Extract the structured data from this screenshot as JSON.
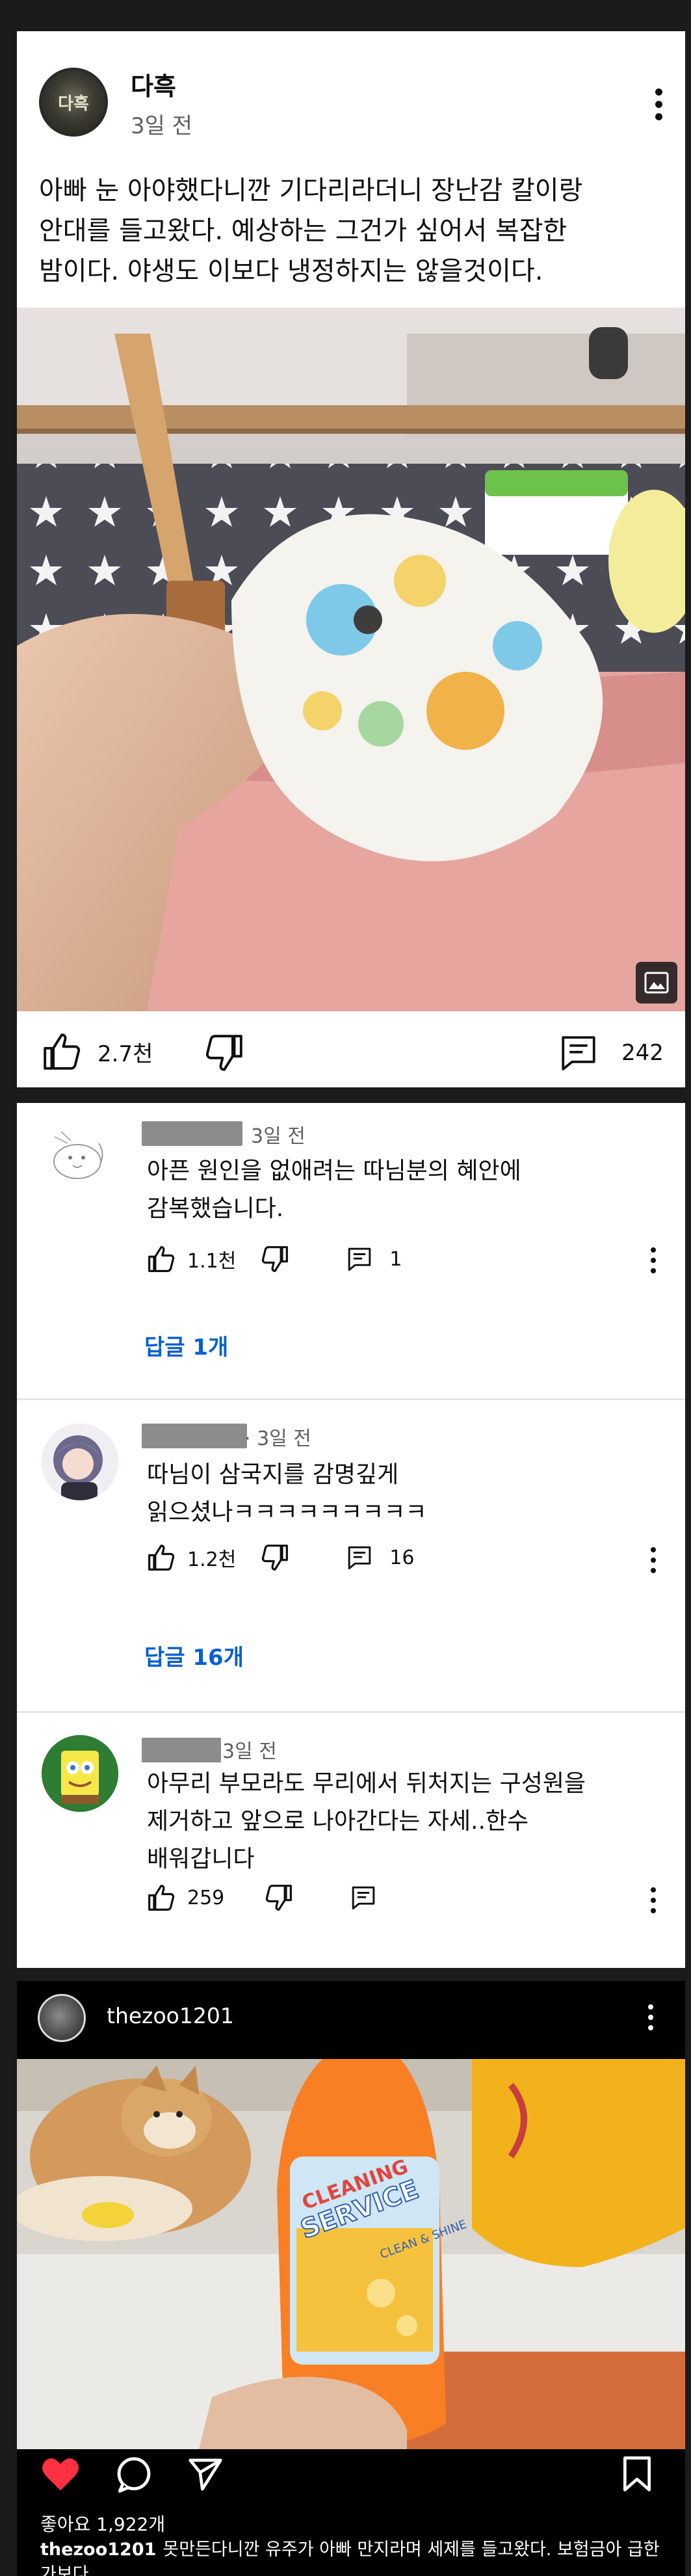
{
  "post": {
    "author": "다흑",
    "avatar_text": "다흑",
    "time": "3일 전",
    "text": "아빠 눈 아야했다니깐 기다리라더니 장난감 칼이랑\n안대를 들고왔다. 예상하는 그건가 싶어서 복잡한\n밤이다. 야생도 이보다 냉정하지는 않을것이다.",
    "likes": "2.7천",
    "comments": "242"
  },
  "comments": [
    {
      "time": "3일 전",
      "text": "아픈 원인을 없애려는 따님분의 혜안에\n감복했습니다.",
      "likes": "1.1천",
      "replies_count": "1",
      "reply_link": "답글 1개"
    },
    {
      "time": "· 3일 전",
      "text": "따님이 삼국지를 감명깊게\n읽으셨나ㅋㅋㅋㅋㅋㅋㅋㅋㅋ",
      "likes": "1.2천",
      "replies_count": "16",
      "reply_link": "답글 16개"
    },
    {
      "time": "3일 전",
      "text": "아무리 부모라도 무리에서 뒤처지는 구성원을\n제거하고 앞으로 나아간다는 자세..한수\n배워갑니다",
      "likes": "259",
      "replies_count": ""
    }
  ],
  "instagram": {
    "username": "thezoo1201",
    "bottle_text_1": "CLEANING",
    "bottle_text_2": "SERVICE",
    "bottle_text_3": "CLEAN & SHINE",
    "likes": "좋아요 1,922개",
    "caption_user": "thezoo1201",
    "caption_text": "못만든다니깐 유주가 아빠 만지라며 세제를 들고왔다. 보험금아 급한가보다"
  },
  "colors": {
    "reply_link": "#065fd4",
    "heart_red": "#ff3040",
    "page_background": "#1b1b1b"
  },
  "icons": [
    "thumbs-up-icon",
    "thumbs-down-icon",
    "comment-icon",
    "more-icon",
    "image-icon",
    "heart-icon",
    "chat-bubble-icon",
    "send-icon",
    "bookmark-icon"
  ]
}
